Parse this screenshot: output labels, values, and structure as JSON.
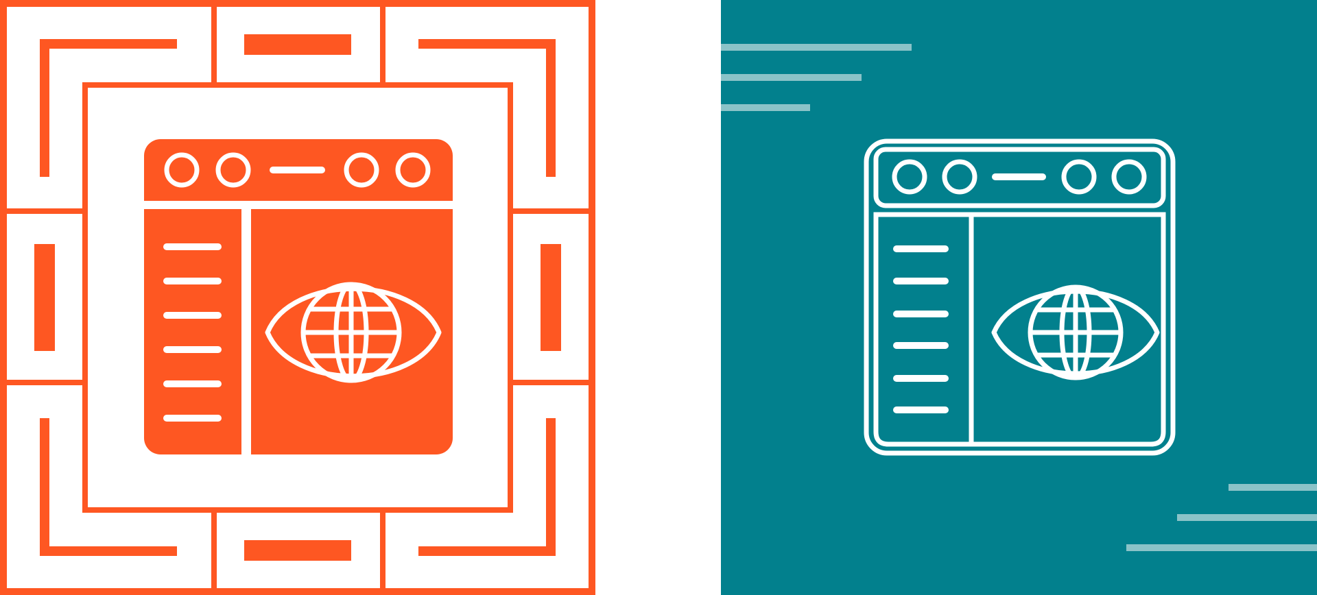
{
  "colors": {
    "background": "#ffffff",
    "accent_orange": "#fe5722",
    "accent_teal": "#02808d",
    "line_white": "#ffffff",
    "stripe_light": "#8bc3c8"
  },
  "icons": {
    "left": "web-watch-glyph-icon",
    "right": "web-watch-line-icon"
  }
}
